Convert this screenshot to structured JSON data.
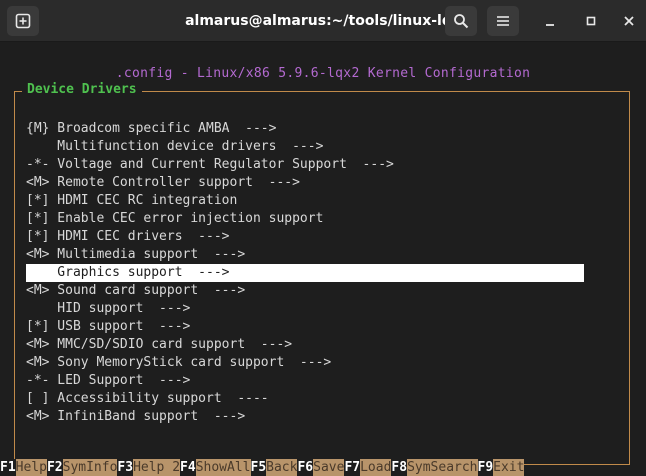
{
  "window": {
    "title": "almarus@almarus:~/tools/linux-lqx"
  },
  "config_title": ".config - Linux/x86 5.9.6-lqx2 Kernel Configuration",
  "section_title": "Device Drivers",
  "menu_items": [
    {
      "text": "{M} Broadcom specific AMBA  --->",
      "selected": false
    },
    {
      "text": "    Multifunction device drivers  --->",
      "selected": false
    },
    {
      "text": "-*- Voltage and Current Regulator Support  --->",
      "selected": false
    },
    {
      "text": "<M> Remote Controller support  --->",
      "selected": false
    },
    {
      "text": "[*] HDMI CEC RC integration",
      "selected": false
    },
    {
      "text": "[*] Enable CEC error injection support",
      "selected": false
    },
    {
      "text": "[*] HDMI CEC drivers  --->",
      "selected": false
    },
    {
      "text": "<M> Multimedia support  --->",
      "selected": false
    },
    {
      "text": "    Graphics support  --->",
      "selected": true
    },
    {
      "text": "<M> Sound card support  --->",
      "selected": false
    },
    {
      "text": "    HID support  --->",
      "selected": false
    },
    {
      "text": "[*] USB support  --->",
      "selected": false
    },
    {
      "text": "<M> MMC/SD/SDIO card support  --->",
      "selected": false
    },
    {
      "text": "<M> Sony MemoryStick card support  --->",
      "selected": false
    },
    {
      "text": "-*- LED Support  --->",
      "selected": false
    },
    {
      "text": "[ ] Accessibility support  ----",
      "selected": false
    },
    {
      "text": "<M> InfiniBand support  --->",
      "selected": false
    }
  ],
  "function_keys": [
    {
      "key": "F1",
      "label": "Help"
    },
    {
      "key": "F2",
      "label": "SymInfo"
    },
    {
      "key": "F3",
      "label": "Help 2"
    },
    {
      "key": "F4",
      "label": "ShowAll"
    },
    {
      "key": "F5",
      "label": "Back"
    },
    {
      "key": "F6",
      "label": "Save"
    },
    {
      "key": "F7",
      "label": "Load"
    },
    {
      "key": "F8",
      "label": "SymSearch"
    },
    {
      "key": "F9",
      "label": "Exit"
    }
  ],
  "icons": {
    "new_tab": "new-tab-icon",
    "search": "search-icon",
    "menu": "hamburger-menu-icon",
    "minimize": "minimize-icon",
    "maximize": "maximize-icon",
    "close": "close-icon"
  }
}
